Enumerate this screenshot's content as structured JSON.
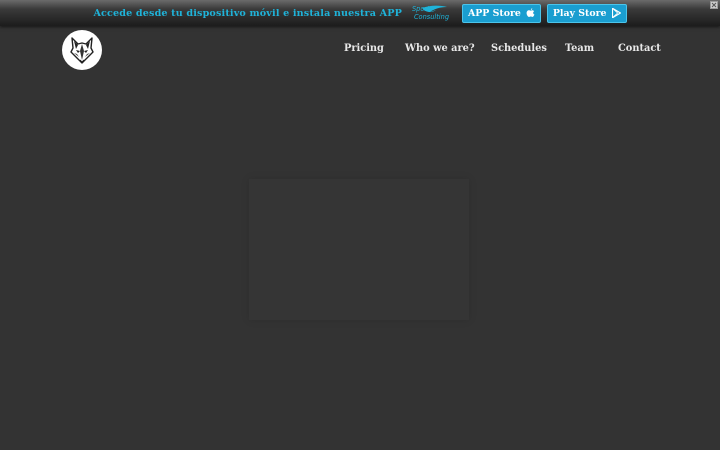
{
  "app_banner": {
    "message": "Accede desde tu dispositivo móvil e instala nuestra APP",
    "brand_line1": "Sport",
    "brand_line2": "Consulting",
    "app_store_label": "APP Store",
    "play_store_label": "Play Store",
    "accent_color": "#1fb3d9",
    "button_color": "#1a9ed0"
  },
  "header": {
    "logo_icon": "wolf-head-icon",
    "nav": [
      {
        "label": "Pricing"
      },
      {
        "label": "Who we are?"
      },
      {
        "label": "Schedules"
      },
      {
        "label": "Team"
      },
      {
        "label": "Contact"
      }
    ]
  },
  "main": {
    "background_color": "#333333"
  }
}
